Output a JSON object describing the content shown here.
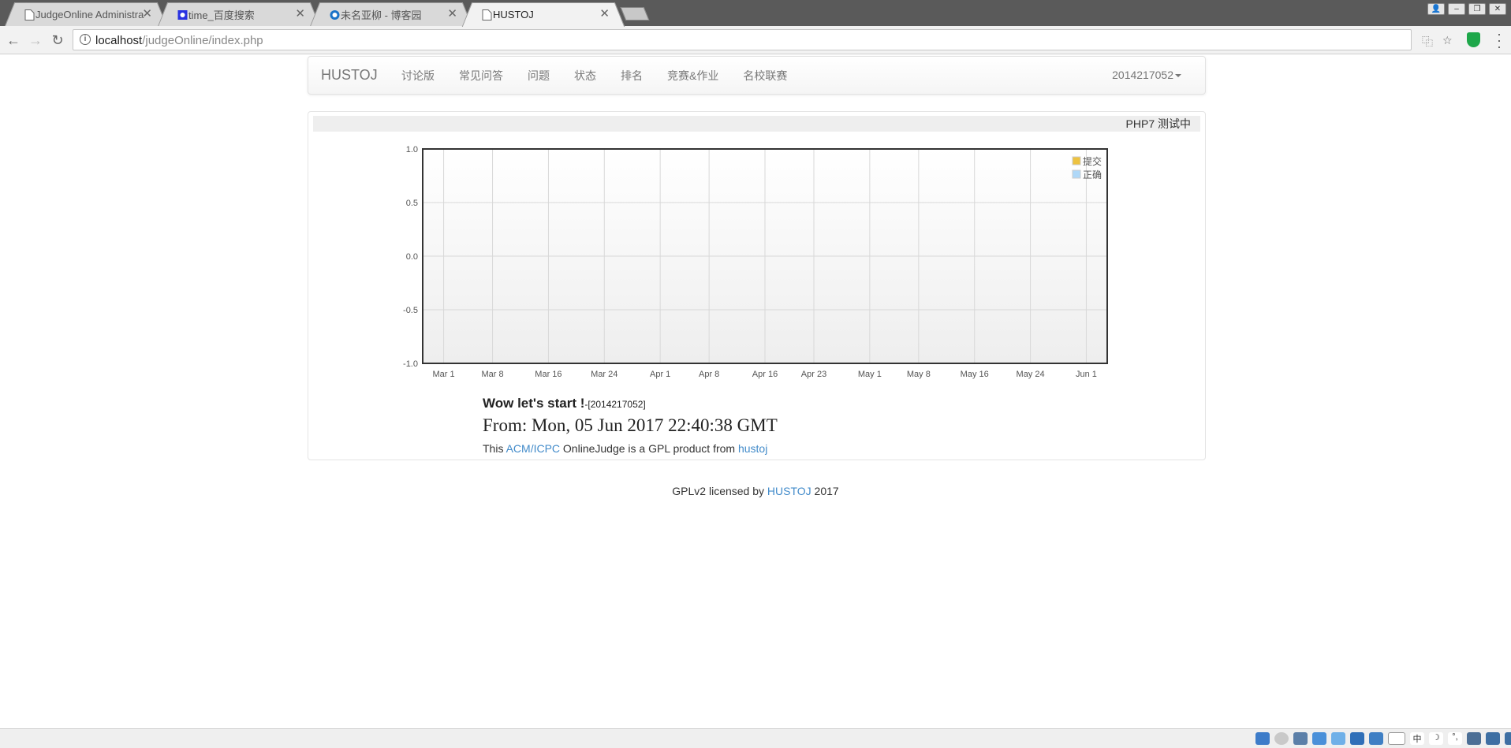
{
  "browser": {
    "tabs": [
      {
        "title": "JudgeOnline Administra",
        "icon": "page-icon",
        "active": false
      },
      {
        "title": "time_百度搜索",
        "icon": "baidu-icon",
        "active": false
      },
      {
        "title": "未名亚柳 - 博客园",
        "icon": "cnblogs-icon",
        "active": false
      },
      {
        "title": "HUSTOJ",
        "icon": "page-icon",
        "active": true
      }
    ],
    "url_host": "localhost",
    "url_path": "/judgeOnline/index.php"
  },
  "nav": {
    "brand": "HUSTOJ",
    "items": [
      "讨论版",
      "常见问答",
      "问题",
      "状态",
      "排名",
      "竞赛&作业",
      "名校联赛"
    ],
    "user": "2014217052"
  },
  "marquee": "PHP7 测试中",
  "chart_data": {
    "type": "line",
    "x_ticks": [
      "Mar 1",
      "Mar 8",
      "Mar 16",
      "Mar 24",
      "Apr 1",
      "Apr 8",
      "Apr 16",
      "Apr 23",
      "May 1",
      "May 8",
      "May 16",
      "May 24",
      "Jun 1"
    ],
    "y_ticks": [
      "1.0",
      "0.5",
      "0.0",
      "-0.5",
      "-1.0"
    ],
    "ylim": [
      -1.0,
      1.0
    ],
    "series": [
      {
        "name": "提交",
        "color": "#edc240",
        "values": []
      },
      {
        "name": "正确",
        "color": "#afd8f8",
        "values": []
      }
    ],
    "grid": true,
    "legend": "top-right"
  },
  "welcome": {
    "headline": "Wow let's start !",
    "user_tag": "-[2014217052]",
    "from": "From: Mon, 05 Jun 2017 22:40:38 GMT",
    "gpl_prefix": "This",
    "gpl_link1": "ACM/ICPC",
    "gpl_middle": "OnlineJudge is a GPL product from",
    "gpl_link2": "hustoj"
  },
  "footer": {
    "prefix": "GPLv2 licensed by",
    "link": "HUSTOJ",
    "suffix": "2017"
  }
}
